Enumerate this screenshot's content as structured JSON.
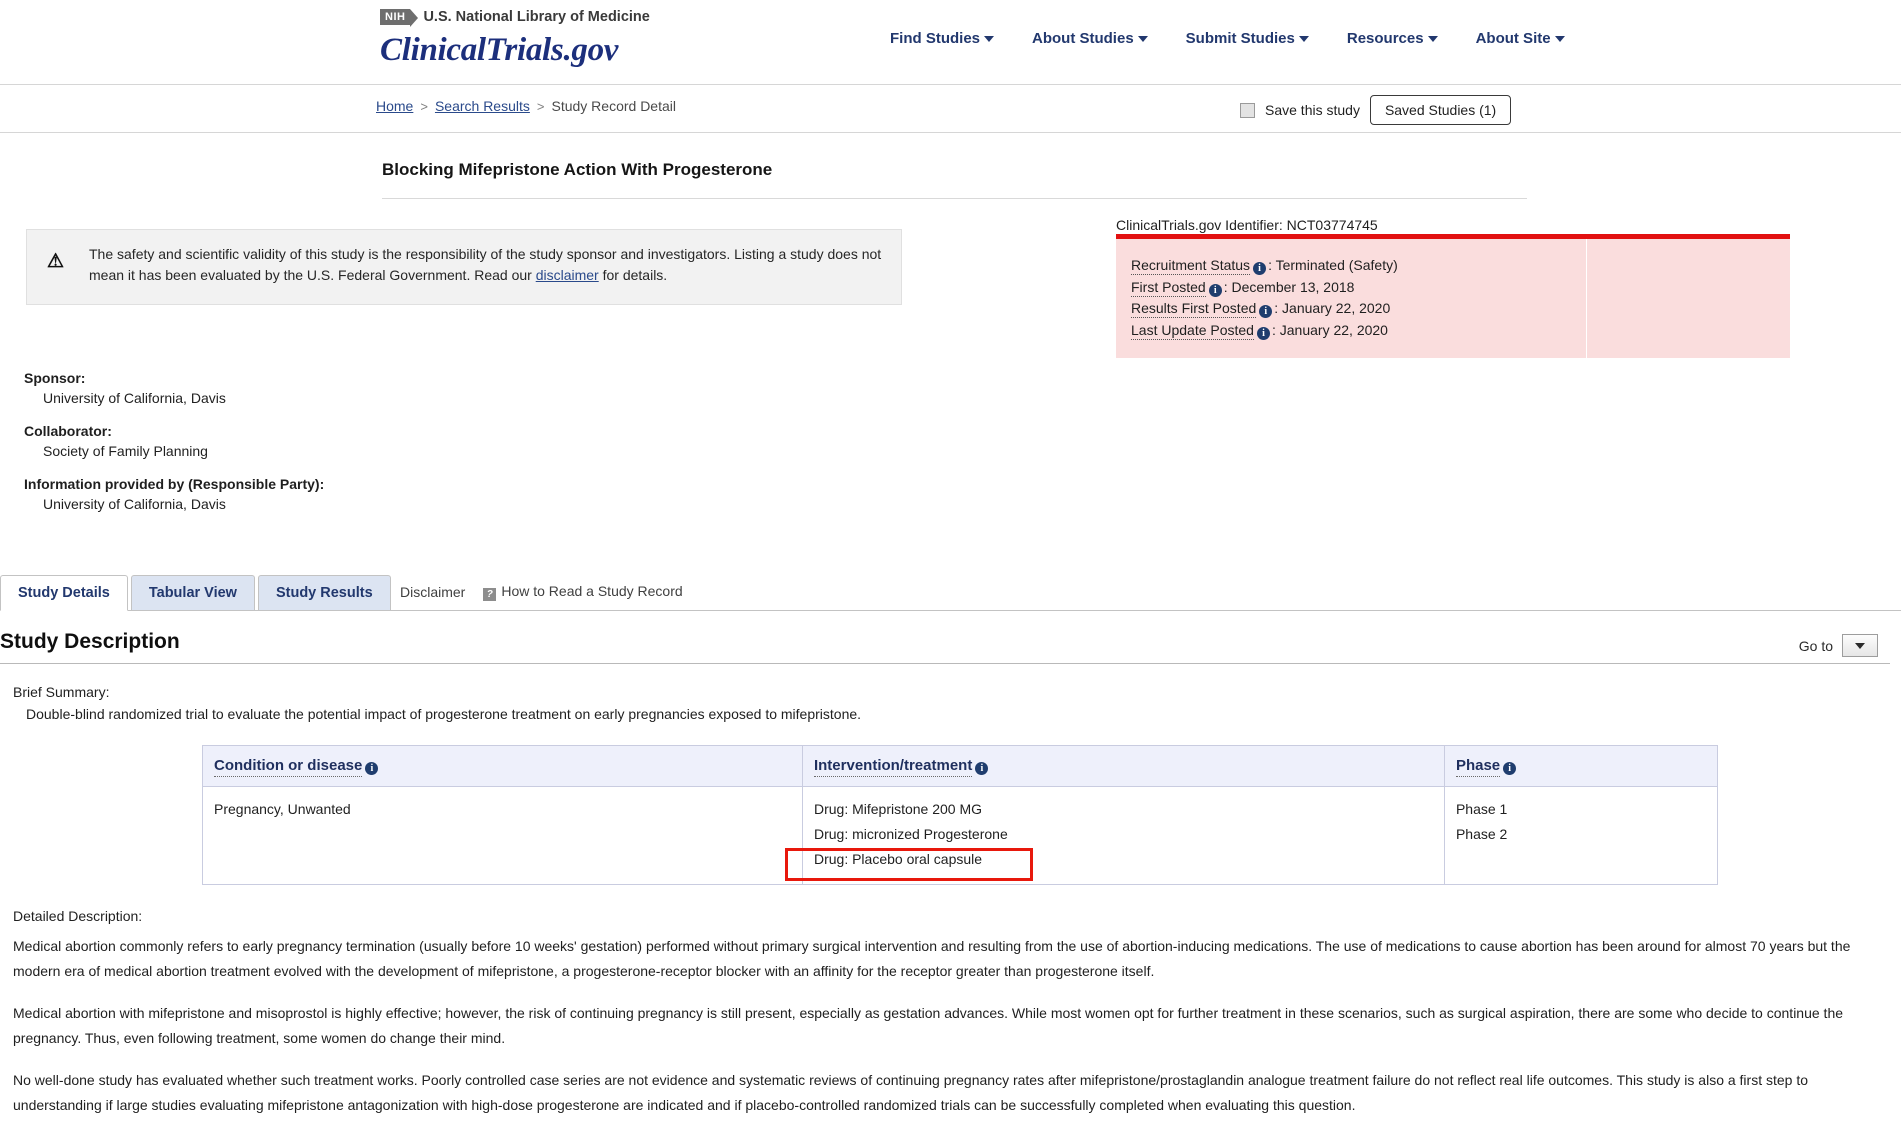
{
  "header": {
    "nih_badge": "NIH",
    "nlm_text": "U.S. National Library of Medicine",
    "logo": "ClinicalTrials.gov",
    "nav": [
      {
        "label": "Find Studies"
      },
      {
        "label": "About Studies"
      },
      {
        "label": "Submit Studies"
      },
      {
        "label": "Resources"
      },
      {
        "label": "About Site"
      }
    ]
  },
  "breadcrumb": {
    "home": "Home",
    "sep1": ">",
    "search_results": "Search Results",
    "sep2": ">",
    "current": "Study Record Detail",
    "save_checkbox_label": "Save this study",
    "saved_studies_button": "Saved Studies (1)"
  },
  "study": {
    "title": "Blocking Mifepristone Action With Progesterone",
    "warning_icon": "warning-triangle",
    "warning_text_1": "The safety and scientific validity of this study is the responsibility of the study sponsor and investigators. Listing a study does not mean it has been evaluated by the U.S. Federal Government. Read our ",
    "warning_link": "disclaimer",
    "warning_text_2": " for details.",
    "identifier_label": "ClinicalTrials.gov Identifier:",
    "identifier_value": "NCT03774745",
    "status_rows": [
      {
        "label": "Recruitment Status",
        "value": "Terminated (Safety)"
      },
      {
        "label": "First Posted",
        "value": "December 13, 2018"
      },
      {
        "label": "Results First Posted",
        "value": "January 22, 2020"
      },
      {
        "label": "Last Update Posted",
        "value": "January 22, 2020"
      }
    ],
    "parties": [
      {
        "label": "Sponsor:",
        "value": "University of California, Davis"
      },
      {
        "label": "Collaborator:",
        "value": "Society of Family Planning"
      },
      {
        "label": "Information provided by (Responsible Party):",
        "value": "University of California, Davis"
      }
    ]
  },
  "tabs": {
    "items": [
      {
        "label": "Study Details"
      },
      {
        "label": "Tabular View"
      },
      {
        "label": "Study Results"
      }
    ],
    "disclaimer": "Disclaimer",
    "how_to_read": "How to Read a Study Record"
  },
  "section": {
    "heading": "Study Description",
    "goto_label": "Go to"
  },
  "brief": {
    "label": "Brief Summary:",
    "text": "Double-blind randomized trial to evaluate the potential impact of progesterone treatment on early pregnancies exposed to mifepristone."
  },
  "conditions_table": {
    "headers": [
      "Condition or disease",
      "Intervention/treatment",
      "Phase"
    ],
    "condition": "Pregnancy, Unwanted",
    "interventions": [
      "Drug: Mifepristone 200 MG",
      "Drug: micronized Progesterone",
      "Drug: Placebo oral capsule"
    ],
    "phases": [
      "Phase 1",
      "Phase 2"
    ],
    "highlight_color": "#e8180c"
  },
  "detailed": {
    "label": "Detailed Description:",
    "paragraphs": [
      "Medical abortion commonly refers to early pregnancy termination (usually before 10 weeks' gestation) performed without primary surgical intervention and resulting from the use of abortion-inducing medications. The use of medications to cause abortion has been around for almost 70 years but the modern era of medical abortion treatment evolved with the development of mifepristone, a progesterone-receptor blocker with an affinity for the receptor greater than progesterone itself.",
      "Medical abortion with mifepristone and misoprostol is highly effective; however, the risk of continuing pregnancy is still present, especially as gestation advances. While most women opt for further treatment in these scenarios, such as surgical aspiration, there are some who decide to continue the pregnancy. Thus, even following treatment, some women do change their mind.",
      "No well-done study has evaluated whether such treatment works. Poorly controlled case series are not evidence and systematic reviews of continuing pregnancy rates after mifepristone/prostaglandin analogue treatment failure do not reflect real life outcomes. This study is also a first step to understanding if large studies evaluating mifepristone antagonization with high-dose progesterone are indicated and if placebo-controlled randomized trials can be successfully completed when evaluating this question."
    ]
  },
  "colors": {
    "brand_blue": "#1c2f7c",
    "nav_blue": "#22386e",
    "status_red": "#e21010",
    "status_bg": "#fadddd"
  }
}
